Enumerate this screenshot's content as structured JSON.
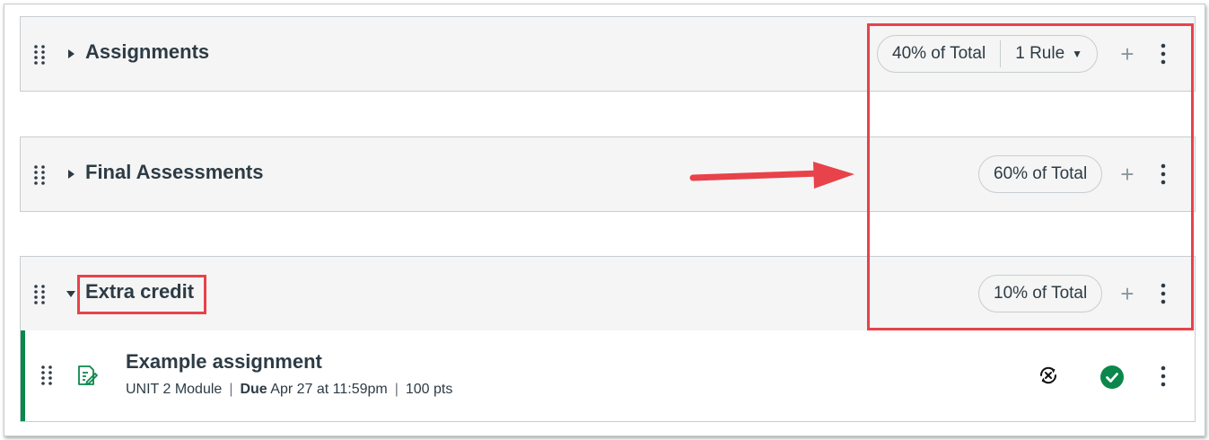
{
  "groups": [
    {
      "title": "Assignments",
      "weight": "40% of Total",
      "rules": "1 Rule",
      "expanded": false
    },
    {
      "title": "Final Assessments",
      "weight": "60% of Total",
      "expanded": false
    },
    {
      "title": "Extra credit",
      "weight": "10% of Total",
      "expanded": true
    }
  ],
  "assignment": {
    "title": "Example assignment",
    "module": "UNIT 2 Module",
    "due_label": "Due",
    "due_date": "Apr 27 at 11:59pm",
    "points": "100 pts"
  },
  "icons": {
    "drag": "drag-handle-icon",
    "collapsed": "caret-right-icon",
    "expanded": "caret-down-icon",
    "add": "plus-icon",
    "menu": "kebab-menu-icon",
    "assignment": "assignment-icon",
    "sync": "unpublished-sync-icon",
    "published": "published-check-icon"
  },
  "colors": {
    "published": "#0b874b",
    "annotation": "#e8424a",
    "header_bg": "#f5f5f5"
  }
}
